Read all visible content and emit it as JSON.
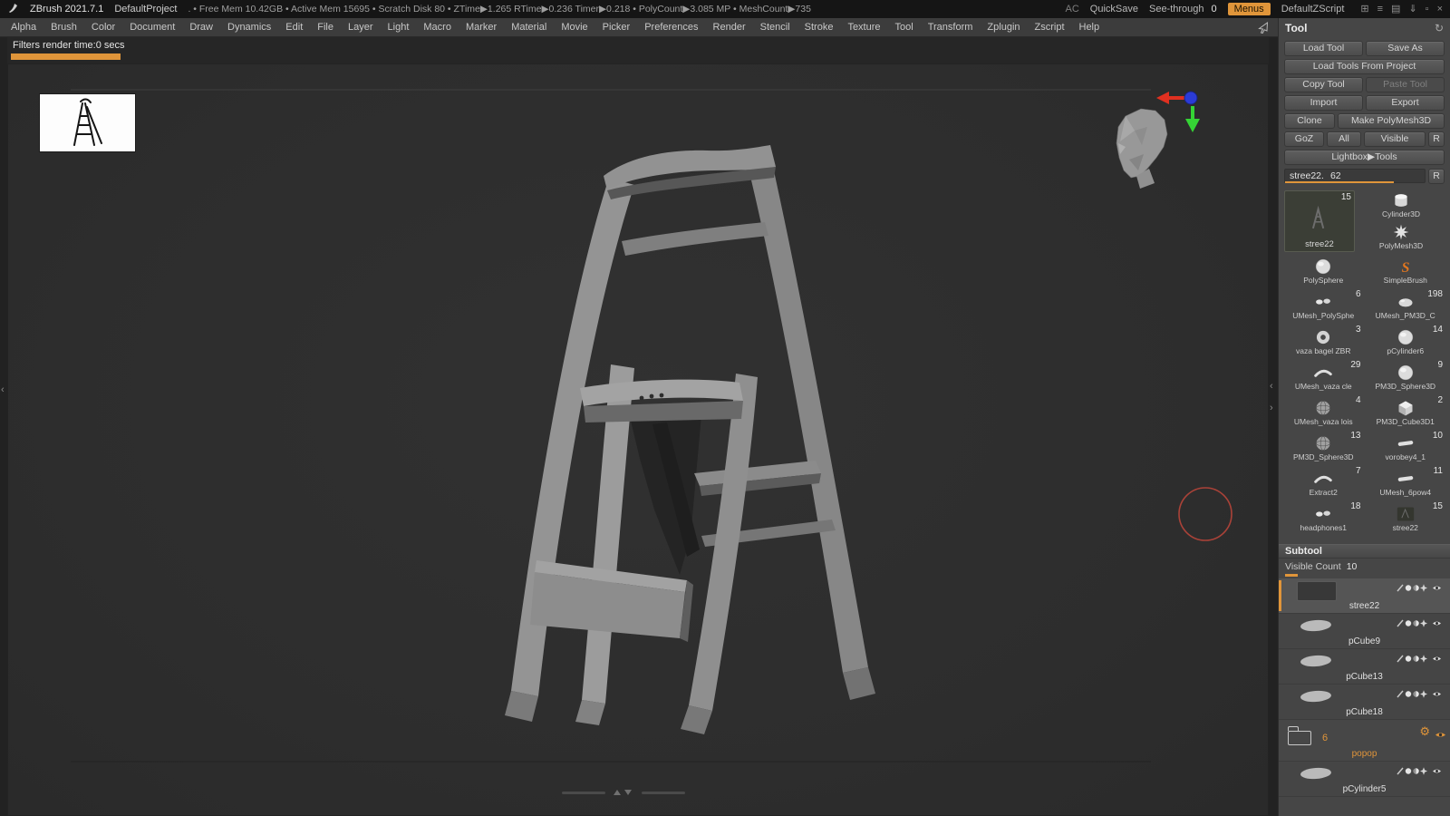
{
  "colors": {
    "accent_orange": "#e0953a",
    "brush_cursor_red": "#b8453a",
    "canvas_gray": "#2e2e2e"
  },
  "title_bar": {
    "app_name": "ZBrush 2021.7.1",
    "project_name": "DefaultProject",
    "stats": ". • Free Mem 10.42GB • Active Mem 15695 • Scratch Disk 80 • ZTime▶1.265 RTime▶0.236 Timer▶0.218 • PolyCount▶3.085 MP • MeshCount▶735",
    "ac": "AC",
    "quicksave": "QuickSave",
    "see_through_label": "See-through",
    "see_through_value": "0",
    "menus": "Menus",
    "zscript": "DefaultZScript",
    "window_icons": [
      {
        "name": "transport-icon",
        "glyph": "⊞"
      },
      {
        "name": "bars-icon",
        "glyph": "≡"
      },
      {
        "name": "grid-icon",
        "glyph": "▤"
      },
      {
        "name": "download-icon",
        "glyph": "⇓"
      },
      {
        "name": "minimize-icon",
        "glyph": "▫"
      },
      {
        "name": "close-icon",
        "glyph": "×"
      }
    ]
  },
  "menu_bar": {
    "items": [
      "Alpha",
      "Brush",
      "Color",
      "Document",
      "Draw",
      "Dynamics",
      "Edit",
      "File",
      "Layer",
      "Light",
      "Macro",
      "Marker",
      "Material",
      "Movie",
      "Picker",
      "Preferences",
      "Render",
      "Stencil",
      "Stroke",
      "Texture",
      "Tool",
      "Transform",
      "Zplugin",
      "Zscript",
      "Help"
    ]
  },
  "status_bar": {
    "filters_text": "Filters render time:0 secs"
  },
  "edges": {
    "collapse_left": "‹",
    "collapse_right_top": "‹",
    "collapse_right_bottom": "›"
  },
  "tool_panel": {
    "title": "Tool",
    "refresh_icon": "↻",
    "buttons": {
      "load_tool": "Load Tool",
      "save_as": "Save As",
      "load_tools_from_project": "Load Tools From Project",
      "copy_tool": "Copy Tool",
      "paste_tool": "Paste Tool",
      "import": "Import",
      "export": "Export",
      "clone": "Clone",
      "make_polymesh3d": "Make PolyMesh3D",
      "goz": "GoZ",
      "all": "All",
      "visible": "Visible",
      "r": "R",
      "lightbox_tools": "Lightbox▶Tools"
    },
    "active_tool": {
      "label": "stree22.",
      "value": "62",
      "r": "R"
    },
    "grid": {
      "selected": {
        "name": "stree22",
        "count": "15"
      },
      "items": [
        {
          "name": "Cylinder3D",
          "count": "",
          "icon": "cylinder"
        },
        {
          "name": "PolyMesh3D",
          "count": "",
          "icon": "star"
        },
        {
          "name": "PolySphere",
          "count": "",
          "icon": "sphere"
        },
        {
          "name": "SimpleBrush",
          "count": "",
          "icon": "sbrush"
        },
        {
          "name": "UMesh_PolySphe",
          "count": "6",
          "icon": "blob2"
        },
        {
          "name": "UMesh_PM3D_C",
          "count": "198",
          "icon": "blob"
        },
        {
          "name": "vaza bagel ZBR",
          "count": "3",
          "icon": "donut"
        },
        {
          "name": "pCylinder6",
          "count": "14",
          "icon": "sphere"
        },
        {
          "name": "UMesh_vaza cle",
          "count": "29",
          "icon": "arc"
        },
        {
          "name": "PM3D_Sphere3D",
          "count": "9",
          "icon": "sphere"
        },
        {
          "name": "UMesh_vaza lois",
          "count": "4",
          "icon": "wire"
        },
        {
          "name": "PM3D_Cube3D1",
          "count": "2",
          "icon": "cube"
        },
        {
          "name": "PM3D_Sphere3D",
          "count": "13",
          "icon": "wire"
        },
        {
          "name": "vorobey4_1",
          "count": "10",
          "icon": "strip"
        },
        {
          "name": "Extract2",
          "count": "7",
          "icon": "arc"
        },
        {
          "name": "UMesh_6pow4",
          "count": "11",
          "icon": "strip"
        },
        {
          "name": "headphones1",
          "count": "18",
          "icon": "blob2"
        },
        {
          "name": "stree22",
          "count": "15",
          "icon": "dark"
        }
      ]
    },
    "subtool": {
      "title": "Subtool",
      "visible_count_label": "Visible Count",
      "visible_count_value": "10",
      "items": [
        {
          "name": "stree22",
          "selected": true,
          "type": "mesh"
        },
        {
          "name": "pCube9",
          "type": "mesh"
        },
        {
          "name": "pCube13",
          "type": "mesh"
        },
        {
          "name": "pCube18",
          "type": "mesh"
        },
        {
          "name": "popop",
          "type": "folder",
          "count": "6"
        },
        {
          "name": "pCylinder5",
          "type": "mesh"
        }
      ]
    }
  }
}
